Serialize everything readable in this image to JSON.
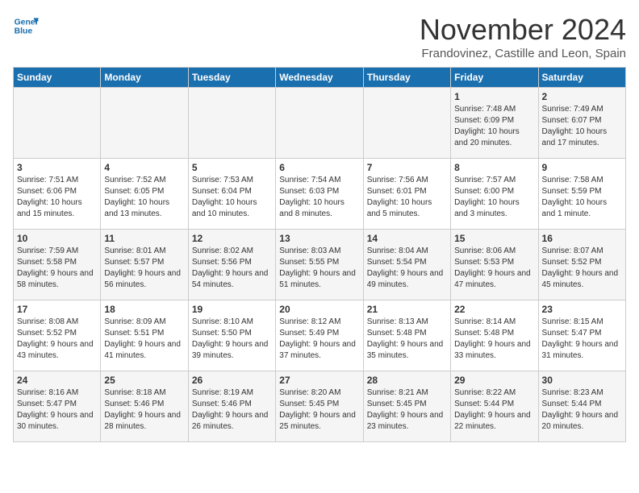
{
  "header": {
    "logo_line1": "General",
    "logo_line2": "Blue",
    "month": "November 2024",
    "location": "Frandovinez, Castille and Leon, Spain"
  },
  "weekdays": [
    "Sunday",
    "Monday",
    "Tuesday",
    "Wednesday",
    "Thursday",
    "Friday",
    "Saturday"
  ],
  "weeks": [
    [
      {
        "day": "",
        "info": ""
      },
      {
        "day": "",
        "info": ""
      },
      {
        "day": "",
        "info": ""
      },
      {
        "day": "",
        "info": ""
      },
      {
        "day": "",
        "info": ""
      },
      {
        "day": "1",
        "info": "Sunrise: 7:48 AM\nSunset: 6:09 PM\nDaylight: 10 hours and 20 minutes."
      },
      {
        "day": "2",
        "info": "Sunrise: 7:49 AM\nSunset: 6:07 PM\nDaylight: 10 hours and 17 minutes."
      }
    ],
    [
      {
        "day": "3",
        "info": "Sunrise: 7:51 AM\nSunset: 6:06 PM\nDaylight: 10 hours and 15 minutes."
      },
      {
        "day": "4",
        "info": "Sunrise: 7:52 AM\nSunset: 6:05 PM\nDaylight: 10 hours and 13 minutes."
      },
      {
        "day": "5",
        "info": "Sunrise: 7:53 AM\nSunset: 6:04 PM\nDaylight: 10 hours and 10 minutes."
      },
      {
        "day": "6",
        "info": "Sunrise: 7:54 AM\nSunset: 6:03 PM\nDaylight: 10 hours and 8 minutes."
      },
      {
        "day": "7",
        "info": "Sunrise: 7:56 AM\nSunset: 6:01 PM\nDaylight: 10 hours and 5 minutes."
      },
      {
        "day": "8",
        "info": "Sunrise: 7:57 AM\nSunset: 6:00 PM\nDaylight: 10 hours and 3 minutes."
      },
      {
        "day": "9",
        "info": "Sunrise: 7:58 AM\nSunset: 5:59 PM\nDaylight: 10 hours and 1 minute."
      }
    ],
    [
      {
        "day": "10",
        "info": "Sunrise: 7:59 AM\nSunset: 5:58 PM\nDaylight: 9 hours and 58 minutes."
      },
      {
        "day": "11",
        "info": "Sunrise: 8:01 AM\nSunset: 5:57 PM\nDaylight: 9 hours and 56 minutes."
      },
      {
        "day": "12",
        "info": "Sunrise: 8:02 AM\nSunset: 5:56 PM\nDaylight: 9 hours and 54 minutes."
      },
      {
        "day": "13",
        "info": "Sunrise: 8:03 AM\nSunset: 5:55 PM\nDaylight: 9 hours and 51 minutes."
      },
      {
        "day": "14",
        "info": "Sunrise: 8:04 AM\nSunset: 5:54 PM\nDaylight: 9 hours and 49 minutes."
      },
      {
        "day": "15",
        "info": "Sunrise: 8:06 AM\nSunset: 5:53 PM\nDaylight: 9 hours and 47 minutes."
      },
      {
        "day": "16",
        "info": "Sunrise: 8:07 AM\nSunset: 5:52 PM\nDaylight: 9 hours and 45 minutes."
      }
    ],
    [
      {
        "day": "17",
        "info": "Sunrise: 8:08 AM\nSunset: 5:52 PM\nDaylight: 9 hours and 43 minutes."
      },
      {
        "day": "18",
        "info": "Sunrise: 8:09 AM\nSunset: 5:51 PM\nDaylight: 9 hours and 41 minutes."
      },
      {
        "day": "19",
        "info": "Sunrise: 8:10 AM\nSunset: 5:50 PM\nDaylight: 9 hours and 39 minutes."
      },
      {
        "day": "20",
        "info": "Sunrise: 8:12 AM\nSunset: 5:49 PM\nDaylight: 9 hours and 37 minutes."
      },
      {
        "day": "21",
        "info": "Sunrise: 8:13 AM\nSunset: 5:48 PM\nDaylight: 9 hours and 35 minutes."
      },
      {
        "day": "22",
        "info": "Sunrise: 8:14 AM\nSunset: 5:48 PM\nDaylight: 9 hours and 33 minutes."
      },
      {
        "day": "23",
        "info": "Sunrise: 8:15 AM\nSunset: 5:47 PM\nDaylight: 9 hours and 31 minutes."
      }
    ],
    [
      {
        "day": "24",
        "info": "Sunrise: 8:16 AM\nSunset: 5:47 PM\nDaylight: 9 hours and 30 minutes."
      },
      {
        "day": "25",
        "info": "Sunrise: 8:18 AM\nSunset: 5:46 PM\nDaylight: 9 hours and 28 minutes."
      },
      {
        "day": "26",
        "info": "Sunrise: 8:19 AM\nSunset: 5:46 PM\nDaylight: 9 hours and 26 minutes."
      },
      {
        "day": "27",
        "info": "Sunrise: 8:20 AM\nSunset: 5:45 PM\nDaylight: 9 hours and 25 minutes."
      },
      {
        "day": "28",
        "info": "Sunrise: 8:21 AM\nSunset: 5:45 PM\nDaylight: 9 hours and 23 minutes."
      },
      {
        "day": "29",
        "info": "Sunrise: 8:22 AM\nSunset: 5:44 PM\nDaylight: 9 hours and 22 minutes."
      },
      {
        "day": "30",
        "info": "Sunrise: 8:23 AM\nSunset: 5:44 PM\nDaylight: 9 hours and 20 minutes."
      }
    ]
  ]
}
